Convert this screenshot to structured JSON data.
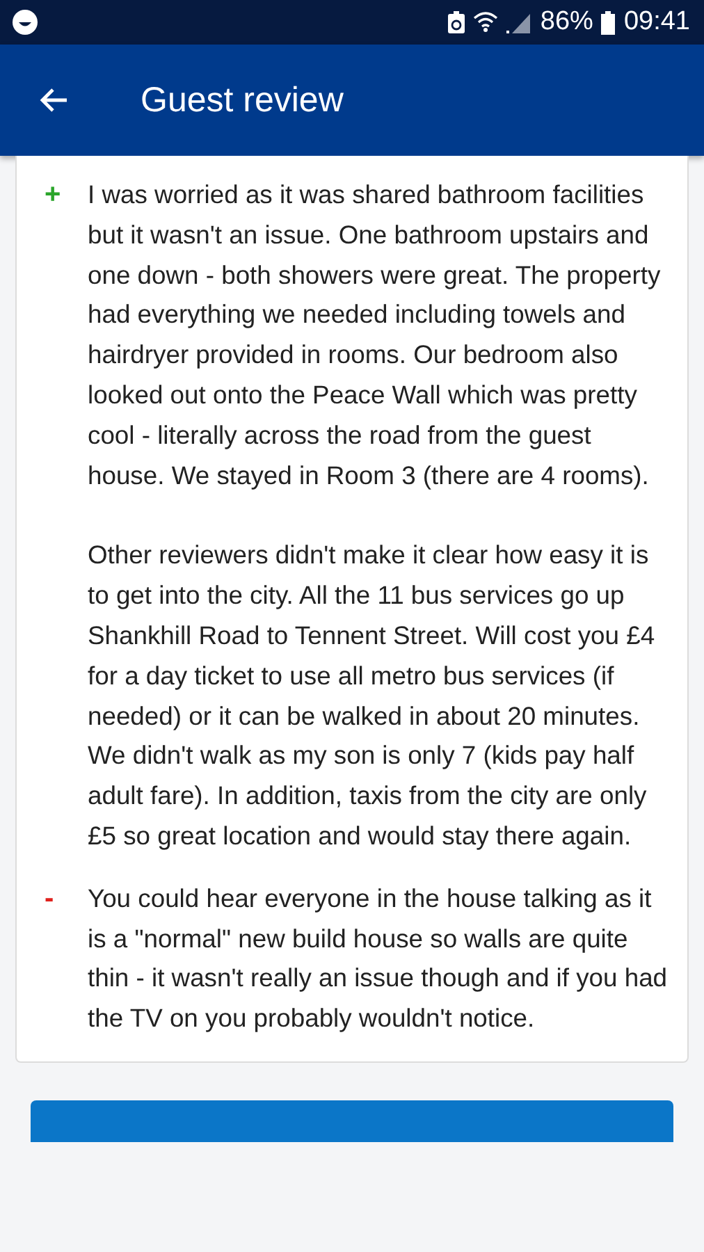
{
  "status_bar": {
    "battery_percent": "86%",
    "time": "09:41"
  },
  "app_bar": {
    "title": "Guest review"
  },
  "review": [
    {
      "kind": "positive",
      "sign": "+",
      "paragraphs": [
        "I was worried as it was shared bathroom facilities but it wasn't an issue. One bathroom upstairs and one down - both showers were great. The property had everything we needed including towels and hairdryer provided in rooms. Our bedroom also looked out onto the Peace Wall which was pretty cool - literally across the road from the guest house. We stayed in Room 3 (there are 4 rooms).",
        "Other reviewers didn't make it clear how easy it is to get into the city. All the 11 bus services go up Shankhill Road to Tennent Street. Will cost you £4 for a day ticket to use all metro bus services (if needed) or it can be walked in about 20 minutes. We didn't walk as my son is only 7 (kids pay half adult fare). In addition, taxis from the city are only £5 so great location and would stay there again."
      ]
    },
    {
      "kind": "negative",
      "sign": "-",
      "paragraphs": [
        "You could hear everyone in the house talking as it is a \"normal\" new build house so walls are quite thin - it wasn't really an issue though and if you had the TV on you probably wouldn't notice."
      ]
    }
  ]
}
